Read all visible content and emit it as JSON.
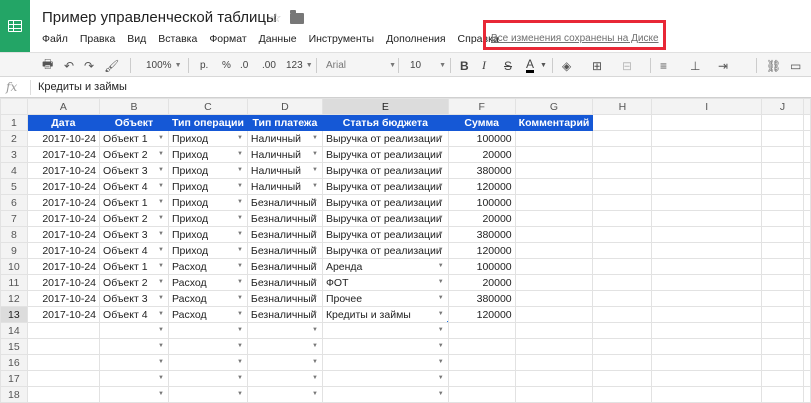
{
  "app": {
    "title": "Пример управленческой таблицы",
    "saved_status": "Все изменения сохранены на Диске",
    "accent": "#23a566",
    "header_fill": "#1558d6",
    "highlight": "#e82836"
  },
  "menu": [
    "Файл",
    "Правка",
    "Вид",
    "Вставка",
    "Формат",
    "Данные",
    "Инструменты",
    "Дополнения",
    "Справка"
  ],
  "toolbar": {
    "zoom": "100%",
    "currency": "р.",
    "percent": "%",
    "dec_less": ".0",
    "dec_more": ".00",
    "more_formats": "123",
    "font": "Arial",
    "font_size": "10"
  },
  "formula_bar": {
    "fx": "fx",
    "value": "Кредиты и займы"
  },
  "grid": {
    "columns": [
      "A",
      "B",
      "C",
      "D",
      "E",
      "F",
      "G",
      "H",
      "I",
      "J"
    ],
    "headers": [
      "Дата",
      "Объект",
      "Тип операции",
      "Тип платежа",
      "Статья бюджета",
      "Сумма",
      "Комментарий"
    ],
    "rows": [
      [
        "2017-10-24",
        "Объект 1",
        "Приход",
        "Наличный",
        "Выручка от реализации",
        "100000",
        ""
      ],
      [
        "2017-10-24",
        "Объект 2",
        "Приход",
        "Наличный",
        "Выручка от реализации",
        "20000",
        ""
      ],
      [
        "2017-10-24",
        "Объект 3",
        "Приход",
        "Наличный",
        "Выручка от реализации",
        "380000",
        ""
      ],
      [
        "2017-10-24",
        "Объект 4",
        "Приход",
        "Наличный",
        "Выручка от реализации",
        "120000",
        ""
      ],
      [
        "2017-10-24",
        "Объект 1",
        "Приход",
        "Безналичный",
        "Выручка от реализации",
        "100000",
        ""
      ],
      [
        "2017-10-24",
        "Объект 2",
        "Приход",
        "Безналичный",
        "Выручка от реализации",
        "20000",
        ""
      ],
      [
        "2017-10-24",
        "Объект 3",
        "Приход",
        "Безналичный",
        "Выручка от реализации",
        "380000",
        ""
      ],
      [
        "2017-10-24",
        "Объект 4",
        "Приход",
        "Безналичный",
        "Выручка от реализации",
        "120000",
        ""
      ],
      [
        "2017-10-24",
        "Объект 1",
        "Расход",
        "Безналичный",
        "Аренда",
        "100000",
        ""
      ],
      [
        "2017-10-24",
        "Объект 2",
        "Расход",
        "Безналичный",
        "ФОТ",
        "20000",
        ""
      ],
      [
        "2017-10-24",
        "Объект 3",
        "Расход",
        "Безналичный",
        "Прочее",
        "380000",
        ""
      ],
      [
        "2017-10-24",
        "Объект 4",
        "Расход",
        "Безналичный",
        "Кредиты и займы",
        "120000",
        ""
      ]
    ],
    "empty_rows": 5,
    "active_cell": "E13"
  }
}
